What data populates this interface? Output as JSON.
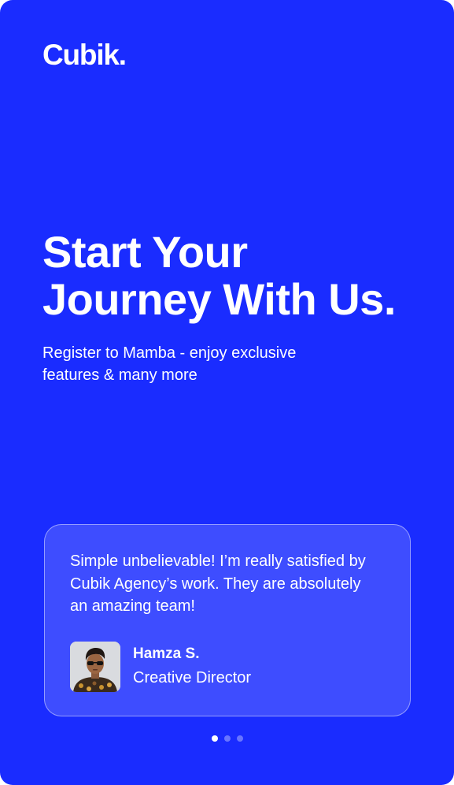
{
  "brand": {
    "logo": "Cubik."
  },
  "hero": {
    "title_line1": "Start Your",
    "title_line2": "Journey With Us.",
    "subtitle_line1": "Register to Mamba - enjoy exclusive",
    "subtitle_line2": "features & many more"
  },
  "testimonial": {
    "quote_line1": "Simple unbelievable! I’m really satisfied by",
    "quote_line2": "Cubik Agency’s work. They are absolutely",
    "quote_line3": "an amazing team!",
    "author_name": "Hamza S.",
    "author_role": "Creative Director"
  },
  "carousel": {
    "total_slides": 3,
    "active_slide": 1
  },
  "colors": {
    "background": "#1A2CFF",
    "text": "#FFFFFF"
  }
}
